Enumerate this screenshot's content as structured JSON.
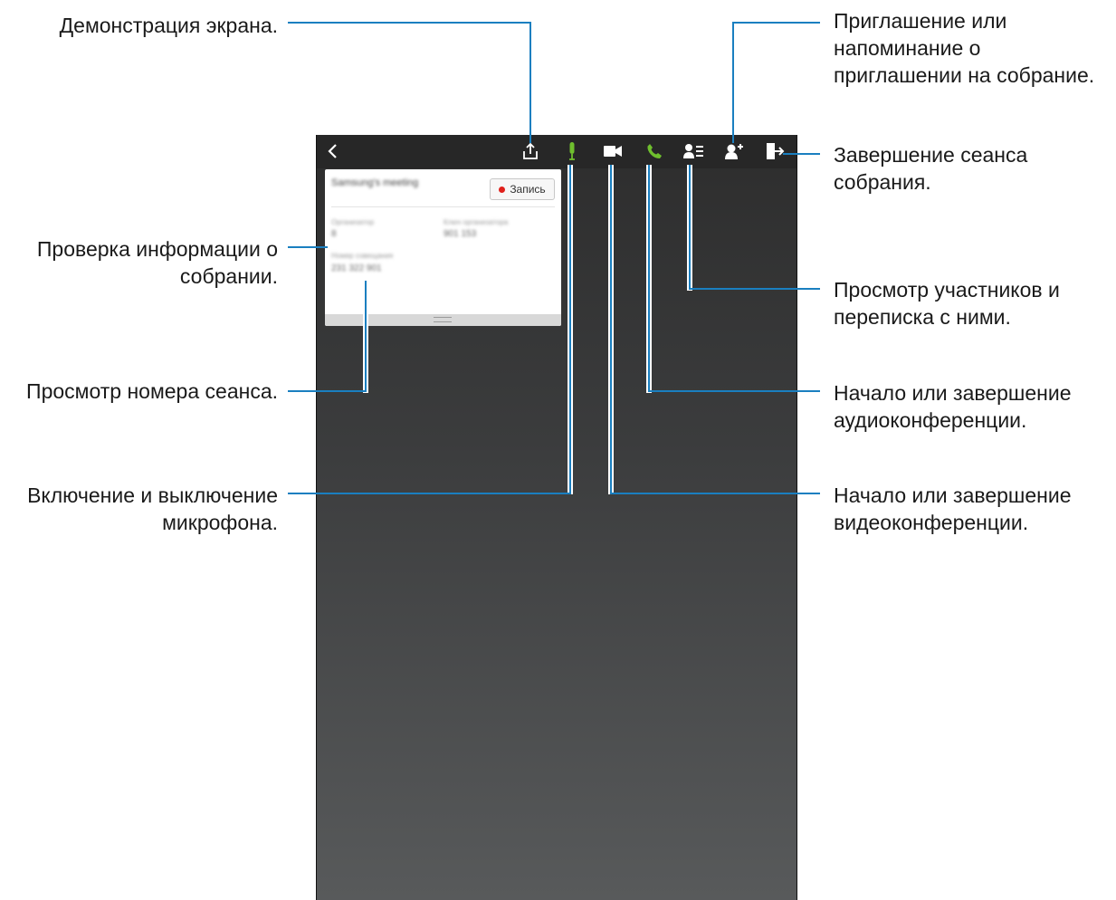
{
  "callouts": {
    "screen_share": "Демонстрация экрана.",
    "invite": "Приглашение или\nнапоминание о\nприглашении на собрание.",
    "end_session": "Завершение сеанса\nсобрания.",
    "meeting_info": "Проверка информации о\nсобрании.",
    "participants": "Просмотр участников и\nпереписка с ними.",
    "session_number": "Просмотр номера сеанса.",
    "audio_conf": "Начало или завершение\nаудиоконференции.",
    "microphone": "Включение и выключение\nмикрофона.",
    "video_conf": "Начало или завершение\nвидеоконференции."
  },
  "toolbar": {
    "icons": [
      "back-icon",
      "share-screen-icon",
      "microphone-icon",
      "video-camera-icon",
      "phone-icon",
      "participants-list-icon",
      "add-person-icon",
      "exit-meeting-icon"
    ],
    "mic_color": "#6fbf2e",
    "phone_color": "#6fbf2e"
  },
  "card": {
    "title": "Samsung's meeting",
    "record_label": "Запись",
    "organizer_label": "Организатор",
    "organizer_value": "8",
    "key_label": "Ключ организатора",
    "key_value": "901 153",
    "number_label": "Номер совещания",
    "number_value": "231 322 901"
  },
  "colors": {
    "leader_line": "#1a7fc0",
    "record_dot": "#e0201b"
  }
}
